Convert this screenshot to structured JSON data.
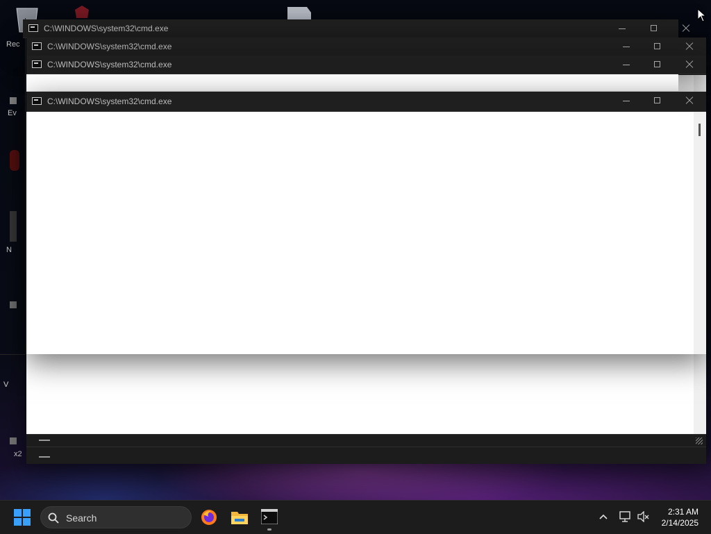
{
  "desktop": {
    "icons": [
      {
        "name": "recycle-bin",
        "label": "Rec"
      },
      {
        "name": "app-icon-red",
        "label": ""
      },
      {
        "name": "file-icon",
        "label": ""
      },
      {
        "name": "ev-shortcut",
        "label": "Ev"
      },
      {
        "name": "n-shortcut",
        "label": "N"
      },
      {
        "name": "v-shortcut",
        "label": "V"
      },
      {
        "name": "x-shortcut",
        "label": "x2"
      }
    ]
  },
  "windows": [
    {
      "title": "C:\\WINDOWS\\system32\\cmd.exe"
    },
    {
      "title": "C:\\WINDOWS\\system32\\cmd.exe"
    },
    {
      "title": "C:\\WINDOWS\\system32\\cmd.exe"
    },
    {
      "title": "C:\\WINDOWS\\system32\\cmd.exe"
    }
  ],
  "taskbar": {
    "search_label": "Search",
    "apps": [
      {
        "name": "firefox",
        "icon": "firefox-icon"
      },
      {
        "name": "file-explorer",
        "icon": "folder-icon"
      },
      {
        "name": "terminal",
        "icon": "terminal-icon"
      }
    ],
    "time": "2:31 AM",
    "date": "2/14/2025"
  },
  "colors": {
    "titlebar": "#1f1f1f",
    "taskbar": "#1c1c1c",
    "client": "#ffffff",
    "start_blue": "#3aa0ff"
  }
}
